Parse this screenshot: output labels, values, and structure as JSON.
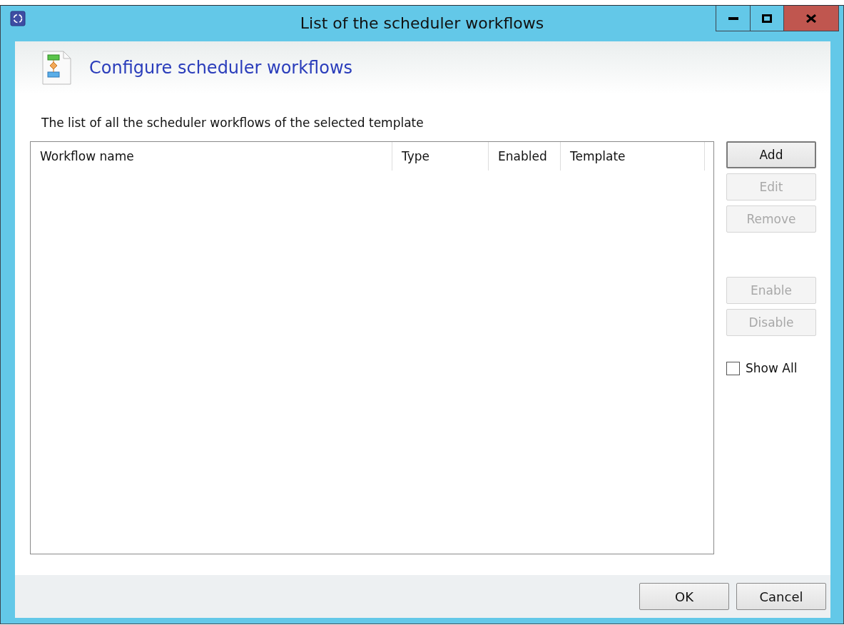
{
  "window": {
    "title": "List of the scheduler workflows"
  },
  "header": {
    "title": "Configure scheduler workflows"
  },
  "description": "The list of all the scheduler workflows of the selected template",
  "table": {
    "columns": [
      "Workflow name",
      "Type",
      "Enabled",
      "Template"
    ]
  },
  "side_buttons": [
    {
      "label": "Add",
      "disabled": false,
      "kind": "button"
    },
    {
      "label": "Edit",
      "disabled": true,
      "kind": "button"
    },
    {
      "label": "Remove",
      "disabled": true,
      "kind": "button"
    },
    {
      "kind": "spacer"
    },
    {
      "label": "Enable",
      "disabled": true,
      "kind": "button"
    },
    {
      "label": "Disable",
      "disabled": true,
      "kind": "button"
    },
    {
      "label": "Show All",
      "checked": false,
      "kind": "checkbox"
    }
  ],
  "footer_buttons": [
    "OK",
    "Cancel"
  ]
}
